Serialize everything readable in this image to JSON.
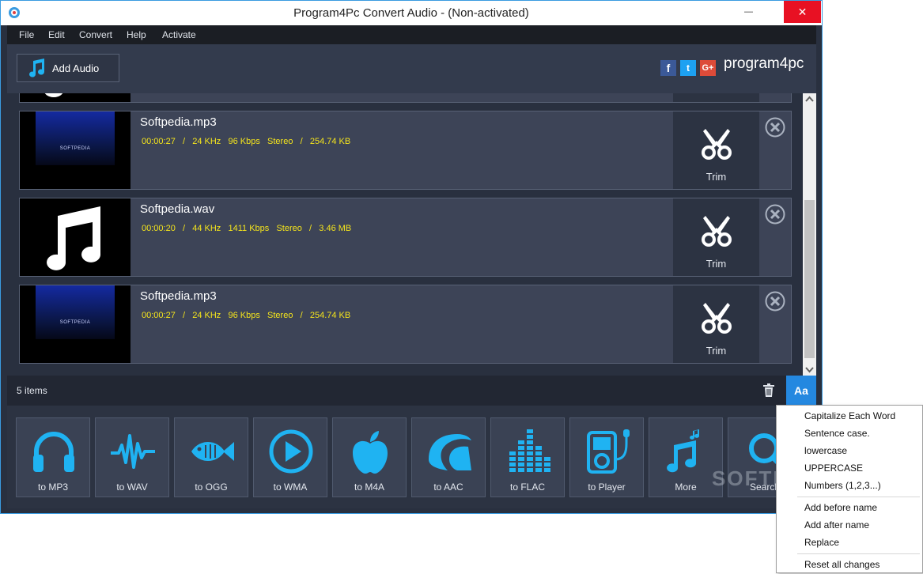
{
  "window": {
    "title": "Program4Pc Convert Audio - (Non-activated)",
    "close_glyph": "✕",
    "minimize_glyph": "—",
    "maximize_glyph": "☐"
  },
  "menu": [
    "File",
    "Edit",
    "Convert",
    "Help",
    "Activate"
  ],
  "toolbar": {
    "add_audio_label": "Add Audio",
    "social": [
      {
        "name": "facebook",
        "glyph": "f",
        "color": "#3b5998"
      },
      {
        "name": "twitter",
        "glyph": "t",
        "color": "#1da1f2"
      },
      {
        "name": "google-plus",
        "glyph": "G+",
        "color": "#dd4b39"
      }
    ],
    "brand": "program4pc"
  },
  "files": [
    {
      "name": "Softpedia.mp3",
      "duration": "00:00:27",
      "rate": "24 KHz",
      "bitrate": "96 Kbps",
      "channels": "Stereo",
      "size": "254.74 KB",
      "thumb": "softpedia",
      "thumb_text": "SOFTPEDIA",
      "trim_label": "Trim"
    },
    {
      "name": "Softpedia.wav",
      "duration": "00:00:20",
      "rate": "44 KHz",
      "bitrate": "1411 Kbps",
      "channels": "Stereo",
      "size": "3.46 MB",
      "thumb": "music-note",
      "thumb_text": "",
      "trim_label": "Trim"
    },
    {
      "name": "Softpedia.mp3",
      "duration": "00:00:27",
      "rate": "24 KHz",
      "bitrate": "96 Kbps",
      "channels": "Stereo",
      "size": "254.74 KB",
      "thumb": "softpedia",
      "thumb_text": "SOFTPEDIA",
      "trim_label": "Trim"
    }
  ],
  "status": {
    "items_count": "5",
    "items_label": "items",
    "aa_label": "Aa"
  },
  "formats": [
    {
      "label": "to MP3",
      "icon": "headphones-icon"
    },
    {
      "label": "to WAV",
      "icon": "waveform-icon"
    },
    {
      "label": "to OGG",
      "icon": "fish-icon"
    },
    {
      "label": "to WMA",
      "icon": "play-circle-icon"
    },
    {
      "label": "to M4A",
      "icon": "apple-icon"
    },
    {
      "label": "to AAC",
      "icon": "aac-swirl-icon"
    },
    {
      "label": "to FLAC",
      "icon": "equalizer-icon"
    },
    {
      "label": "to Player",
      "icon": "player-device-icon"
    },
    {
      "label": "More",
      "icon": "music-notes-icon"
    },
    {
      "label": "Search",
      "icon": "search-icon"
    }
  ],
  "accent_color": "#1fb3f2",
  "meta_color": "#f4e41c",
  "watermark": "SOFTPE",
  "context_menu": {
    "group1": [
      "Capitalize Each Word",
      "Sentence case.",
      "lowercase",
      "UPPERCASE",
      "Numbers (1,2,3...)"
    ],
    "group2": [
      "Add before name",
      "Add after name",
      "Replace"
    ],
    "group3": [
      "Reset all changes"
    ]
  }
}
